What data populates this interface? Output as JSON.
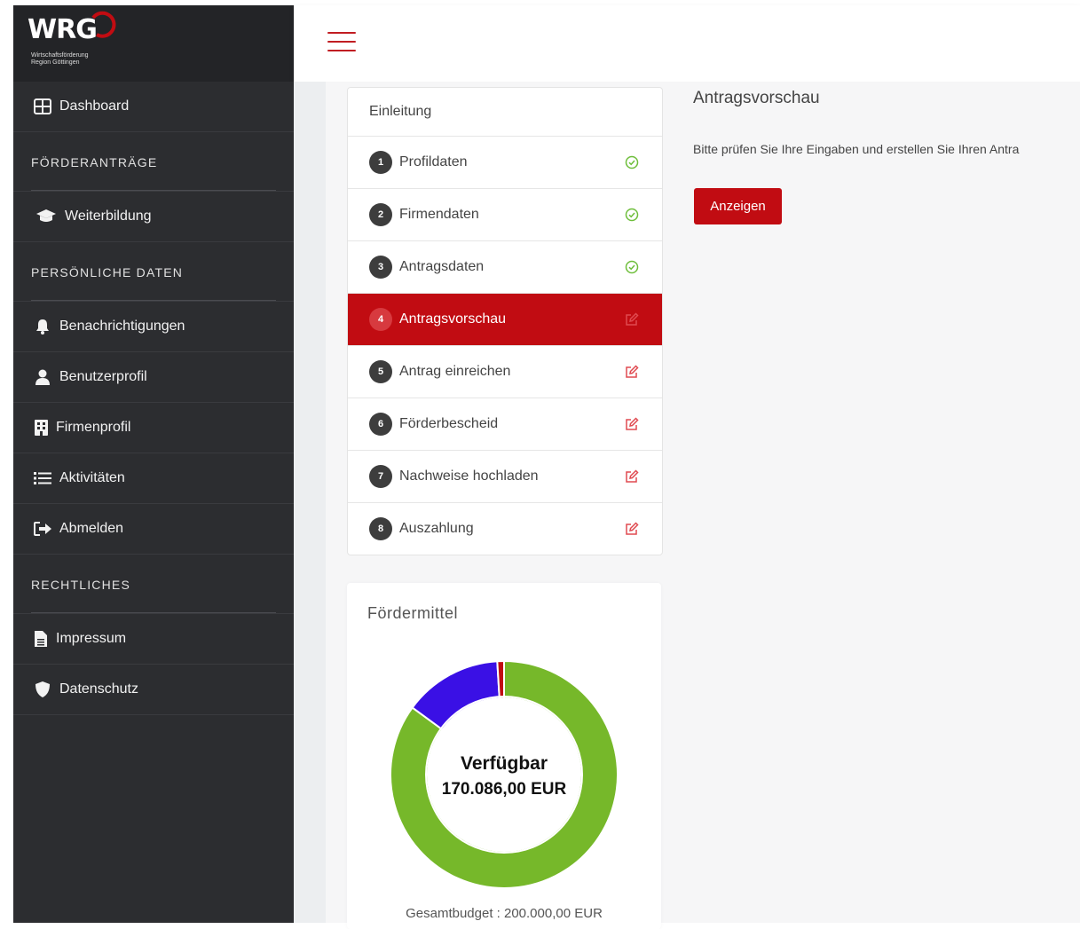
{
  "brand": {
    "logo": "WRG",
    "tagline_line1": "Wirtschaftsförderung",
    "tagline_line2": "Region Göttingen",
    "accent": "#c10c12"
  },
  "sidebar": {
    "dashboard": "Dashboard",
    "section_foerder": "FÖRDERANTRÄGE",
    "weiterbildung": "Weiterbildung",
    "section_personal": "PERSÖNLICHE DATEN",
    "benachrichtigungen": "Benachrichtigungen",
    "benutzerprofil": "Benutzerprofil",
    "firmenprofil": "Firmenprofil",
    "aktivitaeten": "Aktivitäten",
    "abmelden": "Abmelden",
    "section_legal": "RECHTLICHES",
    "impressum": "Impressum",
    "datenschutz": "Datenschutz"
  },
  "steps": {
    "intro": "Einleitung",
    "items": [
      {
        "num": "1",
        "label": "Profildaten",
        "status": "done"
      },
      {
        "num": "2",
        "label": "Firmendaten",
        "status": "done"
      },
      {
        "num": "3",
        "label": "Antragsdaten",
        "status": "done"
      },
      {
        "num": "4",
        "label": "Antragsvorschau",
        "status": "edit"
      },
      {
        "num": "5",
        "label": "Antrag einreichen",
        "status": "edit"
      },
      {
        "num": "6",
        "label": "Förderbescheid",
        "status": "edit"
      },
      {
        "num": "7",
        "label": "Nachweise hochladen",
        "status": "edit"
      },
      {
        "num": "8",
        "label": "Auszahlung",
        "status": "edit"
      }
    ]
  },
  "main": {
    "title": "Antragsvorschau",
    "description": "Bitte prüfen Sie Ihre Eingaben und erstellen Sie Ihren Antra",
    "show_button": "Anzeigen"
  },
  "funds": {
    "title": "Fördermittel",
    "center_label": "Verfügbar",
    "center_value": "170.086,00 EUR",
    "budget": "Gesamtbudget : 200.000,00 EUR"
  },
  "chart_data": {
    "type": "pie",
    "donut": true,
    "total": 200000,
    "series": [
      {
        "value": 170086,
        "color": "#76b82a"
      },
      {
        "value": 28000,
        "color": "#3a10e5"
      },
      {
        "value": 1914,
        "color": "#c10c12"
      }
    ]
  }
}
